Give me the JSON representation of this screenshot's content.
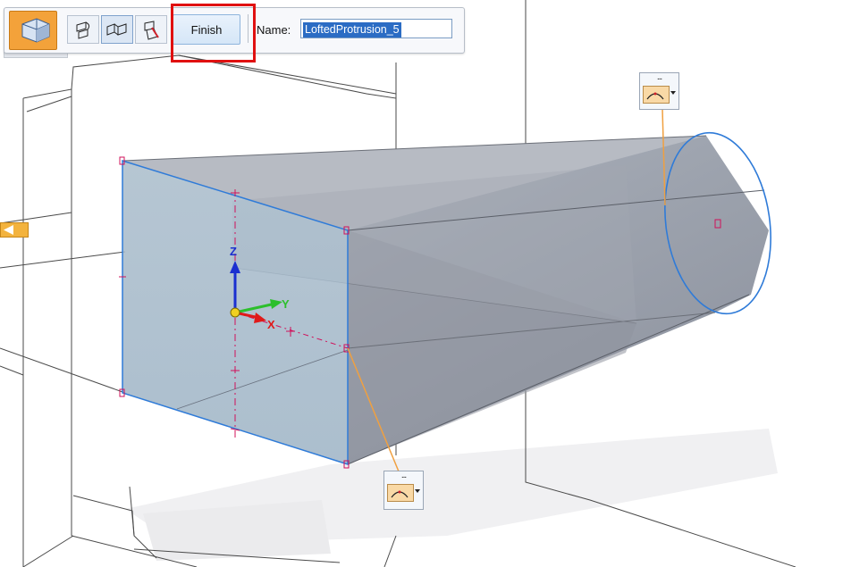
{
  "toolbar": {
    "feature_icon": "lofted-protrusion-icon",
    "tools": [
      {
        "name": "cross-section-step-icon"
      },
      {
        "name": "vertex-mapping-step-icon"
      },
      {
        "name": "guide-curve-step-icon"
      }
    ],
    "finish_label": "Finish",
    "name_label": "Name:",
    "name_value": "LoftedProtrusion_5"
  },
  "viewport": {
    "triad": {
      "z": "Z",
      "y": "Y",
      "x": "X"
    },
    "handle_menu_dots": "...",
    "handles": [
      {
        "name": "tangency-handle-top",
        "icon": "tangency-curve-icon"
      },
      {
        "name": "tangency-handle-bottom",
        "icon": "tangency-curve-icon"
      }
    ]
  },
  "colors": {
    "accent": "#f3a23a",
    "highlight": "#e01010",
    "selection": "#2b6cc4",
    "profile": "#2f7bd8",
    "constraint": "#d0105a"
  }
}
